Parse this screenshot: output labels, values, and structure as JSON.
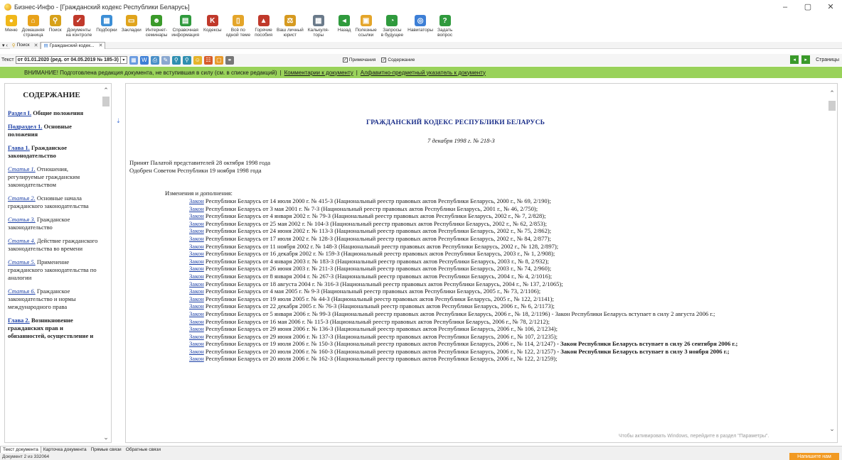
{
  "window": {
    "title": "Бизнес-Инфо - [Гражданский кодекс Республики Беларусь]",
    "controls": [
      "–",
      "▢",
      "✕"
    ]
  },
  "toolbar": [
    {
      "label": "Меню",
      "icon": "menu-icon",
      "color": "#f0b71a"
    },
    {
      "label": "Домашняя\nстраница",
      "icon": "home-icon",
      "color": "#e8a21a"
    },
    {
      "label": "Поиск",
      "icon": "search-icon",
      "color": "#d7a11a"
    },
    {
      "label": "Документы\nна контроле",
      "icon": "documents-control-icon",
      "color": "#c0392b"
    },
    {
      "label": "Подборки",
      "icon": "selections-icon",
      "color": "#3d8fd6"
    },
    {
      "label": "Закладки",
      "icon": "bookmarks-icon",
      "color": "#e0a41c"
    },
    {
      "label": "Интернет-\nсеминары",
      "icon": "webinar-icon",
      "color": "#3a9a2a"
    },
    {
      "label": "Справочная\nинформация",
      "icon": "reference-icon",
      "color": "#2f9a3d"
    },
    {
      "label": "Кодексы",
      "icon": "codes-icon",
      "color": "#c0392b"
    },
    {
      "label": "Всё по\nодной теме",
      "icon": "topic-icon",
      "color": "#e4a52a"
    },
    {
      "label": "Горячие\nпособия",
      "icon": "hot-manuals-icon",
      "color": "#c0392b"
    },
    {
      "label": "Ваш личный\nюрист",
      "icon": "lawyer-icon",
      "color": "#d69a20"
    },
    {
      "label": "Калькуля-\nторы",
      "icon": "calculator-icon",
      "color": "#6a7a8a"
    },
    {
      "label": "Назад",
      "icon": "back-icon",
      "color": "#2f9a3d"
    },
    {
      "label": "Полезные\nссылки",
      "icon": "useful-links-icon",
      "color": "#e4a52a"
    },
    {
      "label": "Запросы\nв будущее",
      "icon": "future-requests-icon",
      "color": "#2f9a3d"
    },
    {
      "label": "Навигаторы",
      "icon": "navigator-icon",
      "color": "#3d7fd6"
    },
    {
      "label": "Задать\nвопрос",
      "icon": "question-icon",
      "color": "#2f9a3d"
    }
  ],
  "tabs": [
    {
      "label": "Поиск"
    },
    {
      "label": "Гражданский кодек..."
    }
  ],
  "editionbar": {
    "label": "Текст",
    "selected": "от 01.01.2020 (ред. от 04.05.2019 № 185-З)",
    "checkbox_notes": "Примечания",
    "checkbox_contents": "Содержание",
    "pages": "Страницы"
  },
  "notice": {
    "text": "ВНИМАНИЕ! Подготовлена редакция документа, не вступившая в силу (см. в списке редакций)",
    "link1": "Комментарии к документу",
    "link2": "Алфавитно-предметный указатель к документу",
    "sep": "|"
  },
  "toc": {
    "heading": "СОДЕРЖАНИЕ",
    "items": [
      {
        "link": "Раздел I.",
        "text": " Общие положения",
        "style": "bold"
      },
      {
        "link": "Подраздел 1.",
        "text": " Основные положения",
        "style": "bold"
      },
      {
        "link": "Глава 1.",
        "text": " Гражданское законодательство",
        "style": "bold"
      },
      {
        "link": "Статья 1.",
        "text": " Отношения, регулируемые гражданским законодательством",
        "style": "italic"
      },
      {
        "link": "Статья 2.",
        "text": " Основные начала гражданского законодательства",
        "style": "italic"
      },
      {
        "link": "Статья 3.",
        "text": " Гражданское законодательство",
        "style": "italic"
      },
      {
        "link": "Статья 4.",
        "text": " Действие гражданского законодательства во времени",
        "style": "italic"
      },
      {
        "link": "Статья 5.",
        "text": " Применение гражданского законодательства по аналогии",
        "style": "italic"
      },
      {
        "link": "Статья 6.",
        "text": " Гражданское законодательство и нормы международного права",
        "style": "italic"
      },
      {
        "link": "Глава 2.",
        "text": " Возникновение гражданских прав и обязанностей, осуществление и",
        "style": "bold"
      }
    ]
  },
  "document": {
    "title": "ГРАЖДАНСКИЙ КОДЕКС РЕСПУБЛИКИ БЕЛАРУСЬ",
    "date": "7 декабря 1998 г. № 218-З",
    "adopted": "Принят Палатой представителей 28 октября 1998 года",
    "approved": "Одобрен Советом Республики 19 ноября 1998 года",
    "changes_heading": "Изменения и дополнения:",
    "amendments": [
      {
        "law": "Закон",
        "text": " Республики Беларусь от 14 июля 2000 г. № 415-З (Национальный реестр правовых актов Республики Беларусь, 2000 г., № 69, 2/190);"
      },
      {
        "law": "Закон",
        "text": " Республики Беларусь от 3 мая 2001 г. № 7-З (Национальный реестр правовых актов Республики Беларусь, 2001 г., № 46, 2/750);"
      },
      {
        "law": "Закон",
        "text": " Республики Беларусь от 4 января 2002 г. № 79-З (Национальный реестр правовых актов Республики Беларусь, 2002 г., № 7, 2/828);"
      },
      {
        "law": "Закон",
        "text": " Республики Беларусь от 25 мая 2002 г. № 104-З (Национальный реестр правовых актов Республики Беларусь, 2002 г., № 62, 2/853);"
      },
      {
        "law": "Закон",
        "text": " Республики Беларусь от 24 июня 2002 г. № 113-З (Национальный реестр правовых актов Республики Беларусь, 2002 г., № 75, 2/862);"
      },
      {
        "law": "Закон",
        "text": " Республики Беларусь от 17 июля 2002 г. № 128-З (Национальный реестр правовых актов Республики Беларусь, 2002 г., № 84, 2/877);"
      },
      {
        "law": "Закон",
        "text": " Республики Беларусь от 11 ноября 2002 г. № 148-З (Национальный реестр правовых актов Республики Беларусь, 2002 г., № 128, 2/897);"
      },
      {
        "law": "Закон",
        "text": " Республики Беларусь от 16 декабря 2002 г. № 159-З (Национальный реестр правовых актов Республики Беларусь, 2003 г., № 1, 2/908);"
      },
      {
        "law": "Закон",
        "text": " Республики Беларусь от 4 января 2003 г. № 183-З (Национальный реестр правовых актов Республики Беларусь, 2003 г., № 8, 2/932);"
      },
      {
        "law": "Закон",
        "text": " Республики Беларусь от 26 июня 2003 г. № 211-З (Национальный реестр правовых актов Республики Беларусь, 2003 г., № 74, 2/960);"
      },
      {
        "law": "Закон",
        "text": " Республики Беларусь от 8 января 2004 г. № 267-З (Национальный реестр правовых актов Республики Беларусь, 2004 г., № 4, 2/1016);"
      },
      {
        "law": "Закон",
        "text": " Республики Беларусь от 18 августа 2004 г. № 316-З (Национальный реестр правовых актов Республики Беларусь, 2004 г., № 137, 2/1065);"
      },
      {
        "law": "Закон",
        "text": " Республики Беларусь от 4 мая 2005 г. № 9-З (Национальный реестр правовых актов Республики Беларусь, 2005 г., № 73, 2/1106);"
      },
      {
        "law": "Закон",
        "text": " Республики Беларусь от 19 июля 2005 г. № 44-З (Национальный реестр правовых актов Республики Беларусь, 2005 г., № 122, 2/1141);"
      },
      {
        "law": "Закон",
        "text": " Республики Беларусь от 22 декабря 2005 г. № 76-З (Национальный реестр правовых актов Республики Беларусь, 2006 г., № 6, 2/1173);"
      },
      {
        "law": "Закон",
        "text": " Республики Беларусь от 5 января 2006 г. № 99-З (Национальный реестр правовых актов Республики Беларусь, 2006 г., № 18, 2/1196) - Закон Республики Беларусь вступает в силу 2 августа 2006 г.;",
        "wrap": true
      },
      {
        "law": "Закон",
        "text": " Республики Беларусь от 16 мая 2006 г. № 115-З (Национальный реестр правовых актов Республики Беларусь, 2006 г., № 78, 2/1212);"
      },
      {
        "law": "Закон",
        "text": " Республики Беларусь от 29 июня 2006 г. № 136-З (Национальный реестр правовых актов Республики Беларусь, 2006 г., № 106, 2/1234);"
      },
      {
        "law": "Закон",
        "text": " Республики Беларусь от 29 июня 2006 г. № 137-З (Национальный реестр правовых актов Республики Беларусь, 2006 г., № 107, 2/1235);"
      },
      {
        "law": "Закон",
        "text": " Республики Беларусь от 19 июля 2006 г. № 150-З (Национальный реестр правовых актов Республики Беларусь, 2006 г., № 114, 2/1247)",
        "bold_tail": " - Закон Республики Беларусь вступает в силу 26 сентября 2006 г.;",
        "wrap": true
      },
      {
        "law": "Закон",
        "text": " Республики Беларусь от 20 июля 2006 г. № 160-З (Национальный реестр правовых актов Республики Беларусь, 2006 г., № 122, 2/1257)",
        "bold_tail": " - Закон Республики Беларусь вступает в силу 3 ноября 2006 г.;",
        "wrap": true
      },
      {
        "law": "Закон",
        "text": " Республики Беларусь от 20 июля 2006 г. № 162-З (Национальный реестр правовых актов Республики Беларусь, 2006 г., № 122, 2/1259);"
      }
    ]
  },
  "windows_activation": "Чтобы активировать Windows, перейдите в раздел \"Параметры\".",
  "bottom_tabs": [
    "Текст документа",
    "Карточка документа",
    "Прямые связи",
    "Обратные связи"
  ],
  "status": {
    "text": "Документ 2 из 332064",
    "write_us": "Напишите нам"
  }
}
